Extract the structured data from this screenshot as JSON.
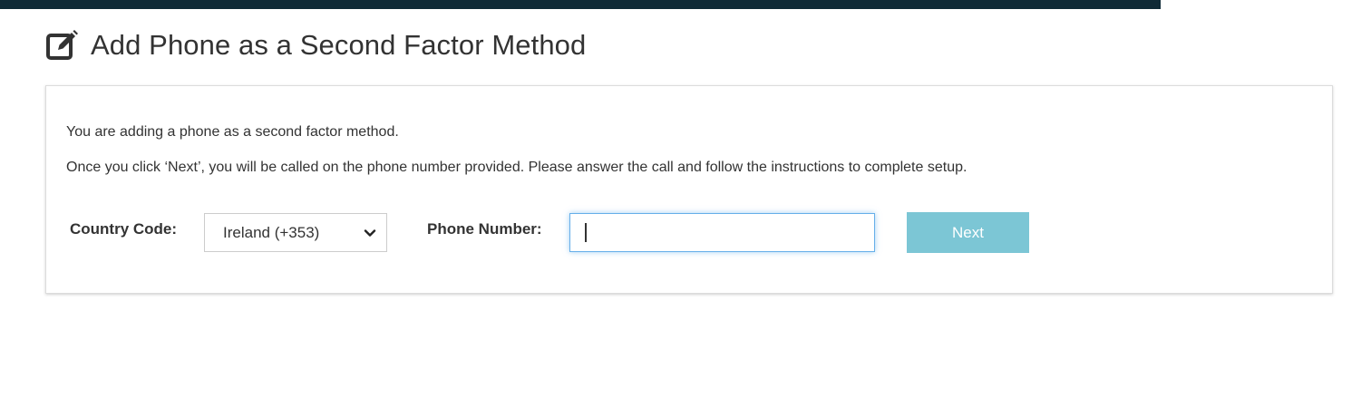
{
  "header": {
    "bar_color": "#0f2a36"
  },
  "page": {
    "title": "Add Phone as a Second Factor Method",
    "title_icon": "edit-icon"
  },
  "panel": {
    "intro_line": "You are adding a phone as a second factor method.",
    "instructions_line": "Once you click ‘Next’, you will be called on the phone number provided. Please answer the call and follow the instructions to complete setup.",
    "country_code_label": "Country Code:",
    "country_code_selected": "Ireland (+353)",
    "phone_number_label": "Phone Number:",
    "phone_number_value": "",
    "next_button_label": "Next",
    "next_button_color": "#7cc6d5"
  }
}
